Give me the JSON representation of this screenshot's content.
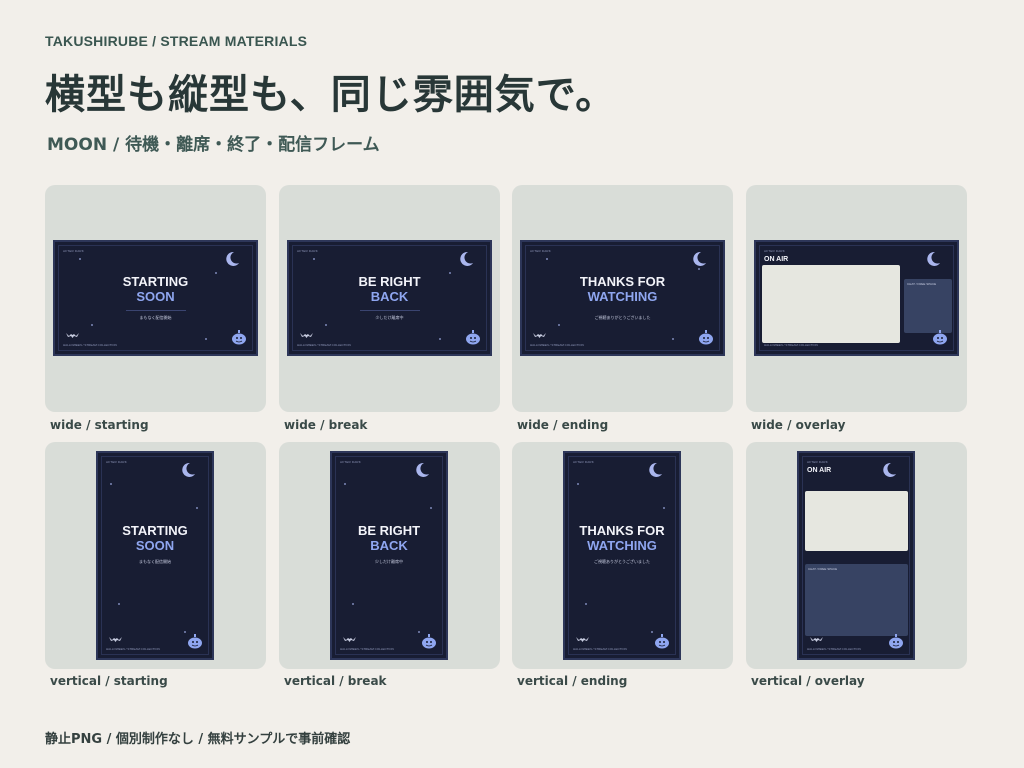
{
  "header": {
    "brand": "TAKUSHIRUBE / STREAM MATERIALS",
    "headline": "横型も縦型も、同じ雰囲気で。",
    "subhead": "MOON / 待機・離席・終了・配信フレーム"
  },
  "thumb_text": {
    "brand": "AFTER DARK",
    "footer": "HALLOWEEN / STREAM COLLECTION",
    "on_air": "ON AIR",
    "chat_area": "CHAT / FREE SPACE"
  },
  "cards": [
    {
      "orientation": "wide",
      "variant": "starting",
      "caption": "wide / starting",
      "title1": "STARTING",
      "title2": "SOON",
      "sub": "まもなく配信開始"
    },
    {
      "orientation": "wide",
      "variant": "break",
      "caption": "wide / break",
      "title1": "BE RIGHT",
      "title2": "BACK",
      "sub": "少しだけ離席中"
    },
    {
      "orientation": "wide",
      "variant": "ending",
      "caption": "wide / ending",
      "title1": "THANKS FOR",
      "title2": "WATCHING",
      "sub": "ご視聴ありがとうございました"
    },
    {
      "orientation": "wide",
      "variant": "overlay",
      "caption": "wide / overlay"
    },
    {
      "orientation": "vertical",
      "variant": "starting",
      "caption": "vertical / starting",
      "title1": "STARTING",
      "title2": "SOON",
      "sub": "まもなく配信開始"
    },
    {
      "orientation": "vertical",
      "variant": "break",
      "caption": "vertical / break",
      "title1": "BE RIGHT",
      "title2": "BACK",
      "sub": "少しだけ離席中"
    },
    {
      "orientation": "vertical",
      "variant": "ending",
      "caption": "vertical / ending",
      "title1": "THANKS FOR",
      "title2": "WATCHING",
      "sub": "ご視聴ありがとうございました"
    },
    {
      "orientation": "vertical",
      "variant": "overlay",
      "caption": "vertical / overlay"
    }
  ],
  "footer": {
    "text": "静止PNG / 個別制作なし / 無料サンプルで事前確認"
  },
  "colors": {
    "page_bg": "#f2efea",
    "card_bg": "#d9ddd8",
    "thumb_bg": "#181d33",
    "accent": "#8fa6f0"
  }
}
